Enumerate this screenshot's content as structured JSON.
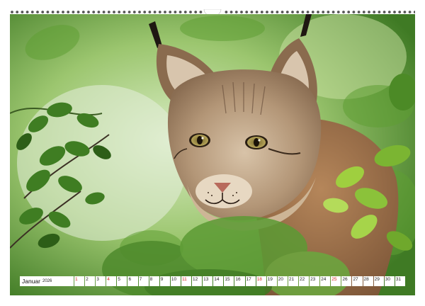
{
  "calendar": {
    "month": "Januar",
    "year": "2026",
    "days": [
      {
        "label": "1",
        "red": true
      },
      {
        "label": "2",
        "red": false
      },
      {
        "label": "3",
        "red": false
      },
      {
        "label": "4",
        "red": true
      },
      {
        "label": "5",
        "red": false
      },
      {
        "label": "6",
        "red": false
      },
      {
        "label": "7",
        "red": false
      },
      {
        "label": "8",
        "red": false
      },
      {
        "label": "9",
        "red": false
      },
      {
        "label": "10",
        "red": false
      },
      {
        "label": "11",
        "red": true
      },
      {
        "label": "12",
        "red": false
      },
      {
        "label": "13",
        "red": false
      },
      {
        "label": "14",
        "red": false
      },
      {
        "label": "15",
        "red": false
      },
      {
        "label": "16",
        "red": false
      },
      {
        "label": "17",
        "red": false
      },
      {
        "label": "18",
        "red": true
      },
      {
        "label": "19",
        "red": false
      },
      {
        "label": "20",
        "red": false
      },
      {
        "label": "21",
        "red": false
      },
      {
        "label": "22",
        "red": false
      },
      {
        "label": "23",
        "red": false
      },
      {
        "label": "24",
        "red": false
      },
      {
        "label": "25",
        "red": true
      },
      {
        "label": "26",
        "red": false
      },
      {
        "label": "27",
        "red": false
      },
      {
        "label": "28",
        "red": false
      },
      {
        "label": "29",
        "red": false
      },
      {
        "label": "30",
        "red": false
      },
      {
        "label": "31",
        "red": false
      }
    ]
  },
  "colors": {
    "sunday_red": "#d4271f",
    "foliage_green": "#4a8f2a",
    "lynx_fur": "#a88a6c"
  }
}
